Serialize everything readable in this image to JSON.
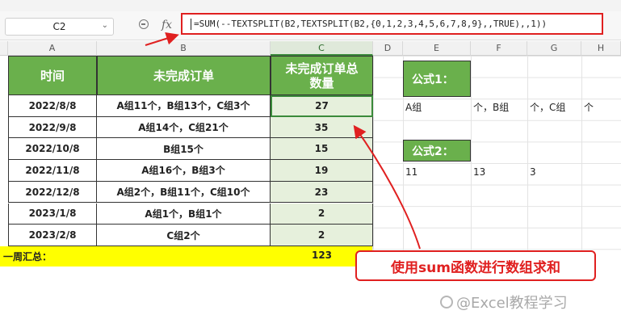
{
  "formula_bar": {
    "name_box": "C2",
    "fx": "fx",
    "formula": "=SUM(--TEXTSPLIT(B2,TEXTSPLIT(B2,{0,1,2,3,4,5,6,7,8,9},,TRUE),,1))"
  },
  "columns": [
    "A",
    "B",
    "C",
    "D",
    "E",
    "F",
    "G",
    "H"
  ],
  "table": {
    "headers": [
      "时间",
      "未完成订单",
      "未完成订单总数量"
    ],
    "rows": [
      {
        "date": "2022/8/8",
        "orders": "A组11个，B组13个，C组3个",
        "qty": "27"
      },
      {
        "date": "2022/9/8",
        "orders": "A组14个，C组21个",
        "qty": "35"
      },
      {
        "date": "2022/10/8",
        "orders": "B组15个",
        "qty": "15"
      },
      {
        "date": "2022/11/8",
        "orders": "A组16个，B组3个",
        "qty": "19"
      },
      {
        "date": "2022/12/8",
        "orders": "A组2个，B组11个，C组10个",
        "qty": "23"
      },
      {
        "date": "2023/1/8",
        "orders": "A组1个，B组1个",
        "qty": "2"
      },
      {
        "date": "2023/2/8",
        "orders": "C组2个",
        "qty": "2"
      }
    ],
    "total_label": "一周汇总：",
    "total_value": "123"
  },
  "side": {
    "formula1_label": "公式1：",
    "formula1_results": [
      "A组",
      "个，B组",
      "个，C组",
      "个"
    ],
    "formula2_label": "公式2：",
    "formula2_results": [
      "11",
      "13",
      "3"
    ]
  },
  "callout": "使用sum函数进行数组求和",
  "watermark": "@Excel教程学习",
  "colors": {
    "header_green": "#6ab04c",
    "highlight_yellow": "#ffff00",
    "annotation_red": "#e02020"
  }
}
